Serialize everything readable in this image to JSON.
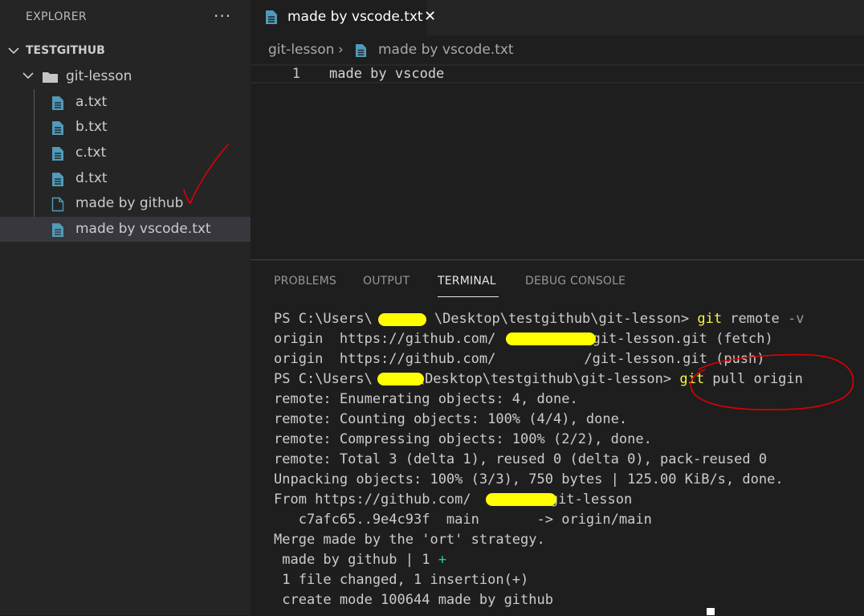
{
  "sidebar": {
    "title": "EXPLORER",
    "more_icon": "···",
    "root": "TESTGITHUB",
    "folder": "git-lesson",
    "files": [
      "a.txt",
      "b.txt",
      "c.txt",
      "d.txt",
      "made by github",
      "made by vscode.txt"
    ]
  },
  "editor": {
    "tab_label": "made by vscode.txt",
    "close_glyph": "✕",
    "breadcrumb": [
      "git-lesson",
      "made by vscode.txt"
    ],
    "breadcrumb_sep": "›",
    "line_number": "1",
    "line_text": "made by vscode"
  },
  "panel": {
    "tabs": [
      "PROBLEMS",
      "OUTPUT",
      "TERMINAL",
      "DEBUG CONSOLE"
    ],
    "active_tab": "TERMINAL"
  },
  "terminal": {
    "l1_a": "PS C:\\Users\\",
    "l1_b": "\\Desktop\\testgithub\\git-lesson> ",
    "l1_cmd": "git",
    "l1_rest": " remote ",
    "l1_flag": "-v",
    "l2_a": "origin  https://github.com/",
    "l2_b": "/git-lesson.git (fetch)",
    "l3_a": "origin  https://github.com/",
    "l3_b": "/git-lesson.git (push)",
    "l4_a": "PS C:\\Users\\",
    "l4_b": "\\Desktop\\testgithub\\git-lesson> ",
    "l4_cmd": "git",
    "l4_rest": " pull origin",
    "l5": "remote: Enumerating objects: 4, done.",
    "l6": "remote: Counting objects: 100% (4/4), done.",
    "l7": "remote: Compressing objects: 100% (2/2), done.",
    "l8": "remote: Total 3 (delta 1), reused 0 (delta 0), pack-reused 0",
    "l9": "Unpacking objects: 100% (3/3), 750 bytes | 125.00 KiB/s, done.",
    "l10_a": "From https://github.com/",
    "l10_b": "/git-lesson",
    "l11": "   c7afc65..9e4c93f  main       -> origin/main",
    "l12": "Merge made by the 'ort' strategy.",
    "l13_a": " made by github | 1 ",
    "l13_b": "+",
    "l14": " 1 file changed, 1 insertion(+)",
    "l15": " create mode 100644 made by github"
  },
  "colors": {
    "annotation_red": "#e00000",
    "redaction_yellow": "#ffff00",
    "file_icon_blue": "#519aba"
  }
}
